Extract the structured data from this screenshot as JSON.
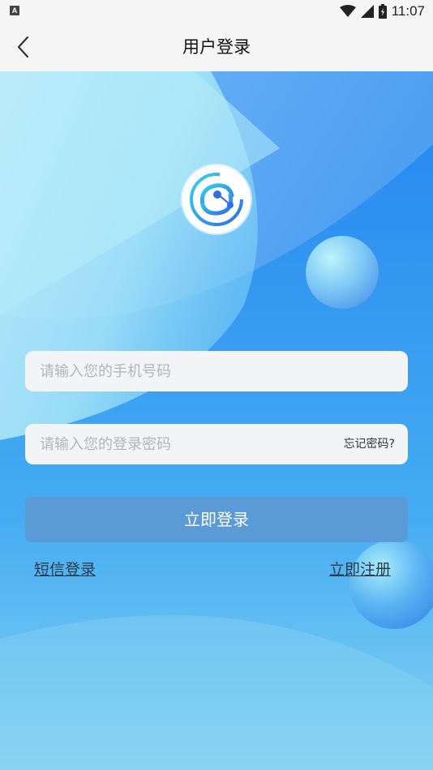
{
  "status_bar": {
    "notification_badge": "A",
    "time": "11:07",
    "icons": [
      "wifi-icon",
      "cell-signal-icon",
      "battery-icon"
    ]
  },
  "header": {
    "title": "用户登录",
    "back_icon": "chevron-left-icon"
  },
  "logo": {
    "icon": "app-logo-icon"
  },
  "form": {
    "phone_placeholder": "请输入您的手机号码",
    "phone_value": "",
    "password_placeholder": "请输入您的登录密码",
    "password_value": "",
    "forgot_label": "忘记密码?",
    "login_label": "立即登录"
  },
  "links": {
    "sms_login": "短信登录",
    "register": "立即注册"
  },
  "colors": {
    "header_bg": "#f5f5f5",
    "hero_blue": "#2b8ff0",
    "login_button": "#5a9ad6",
    "field_bg": "#f2f4f5"
  }
}
